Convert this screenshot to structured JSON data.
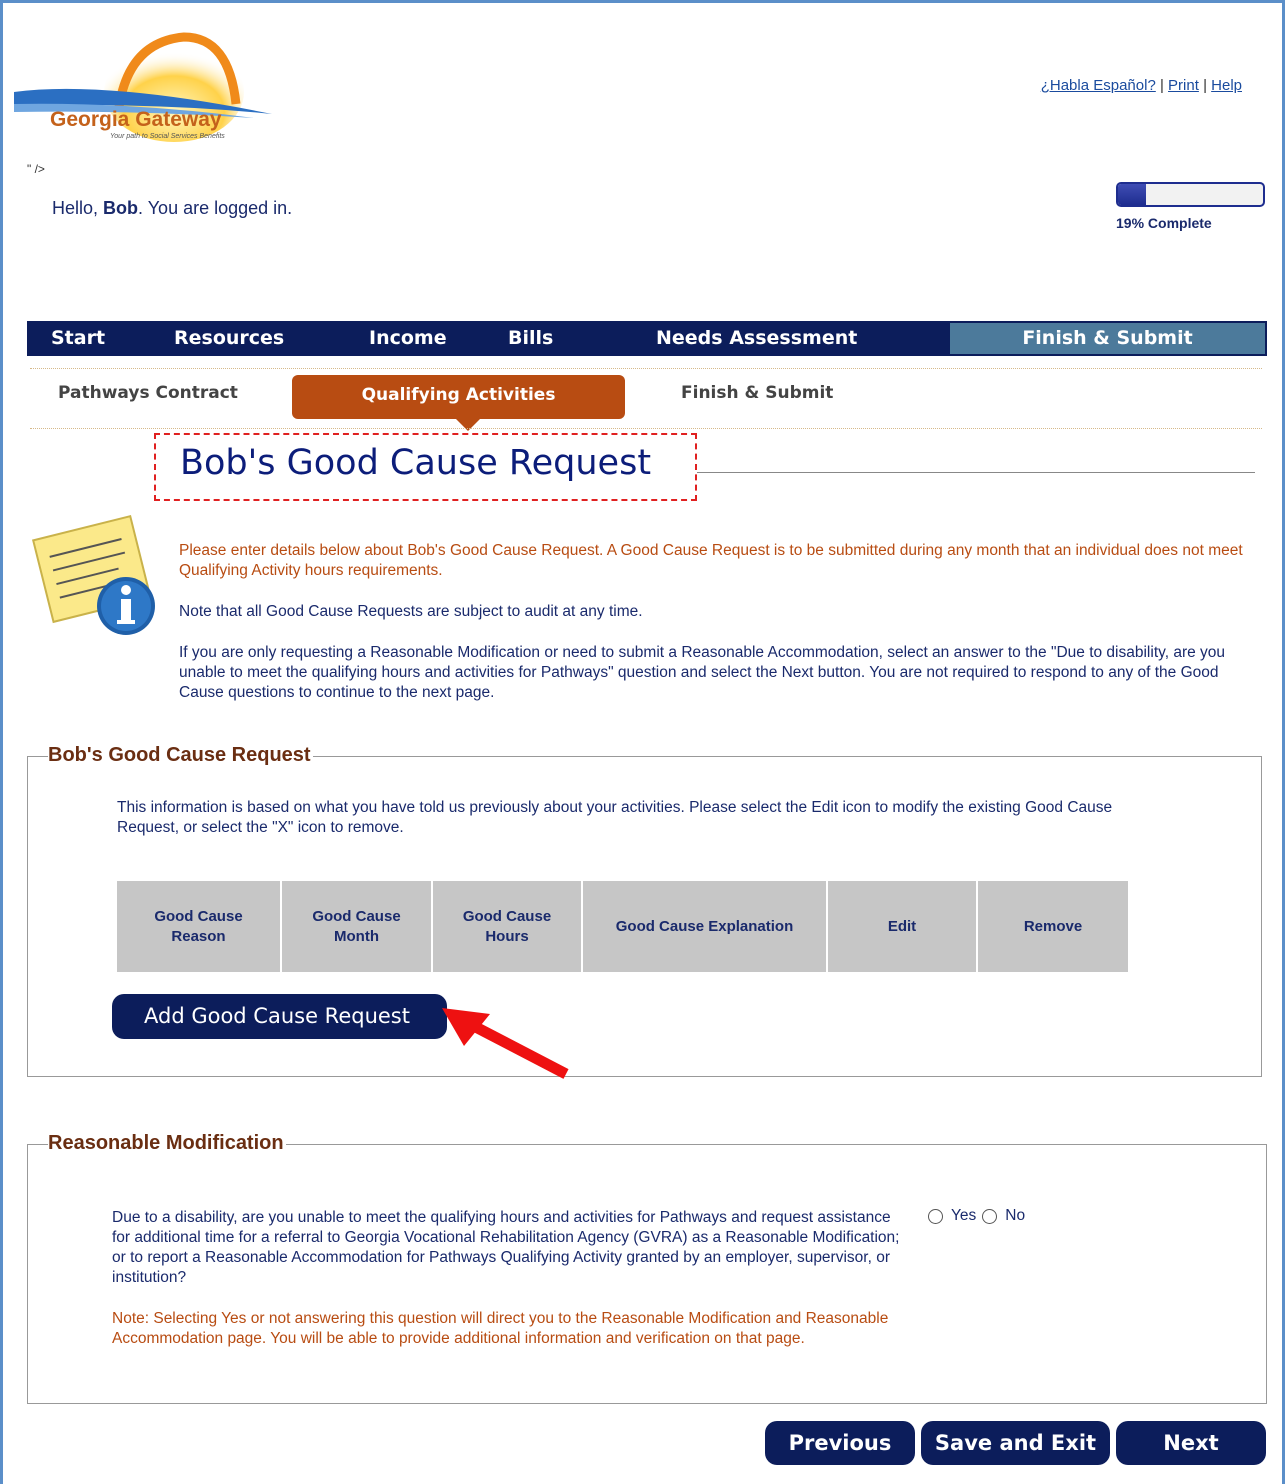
{
  "header": {
    "logo_text": "Georgia Gateway",
    "logo_tagline": "Your path to Social Services Benefits",
    "links": [
      "¿Habla Español?",
      "Print",
      "Help"
    ],
    "stray_text": "\" />",
    "greeting_prefix": "Hello, ",
    "user_name": "Bob",
    "greeting_suffix": ". You are logged in.",
    "progress_percent": 19,
    "progress_label": "19% Complete"
  },
  "main_nav": {
    "items": [
      "Start",
      "Resources",
      "Income",
      "Bills",
      "Needs Assessment",
      "Finish & Submit"
    ],
    "active": "Finish & Submit"
  },
  "sub_nav": {
    "items": [
      "Pathways Contract",
      "Qualifying Activities",
      "Finish & Submit"
    ],
    "active": "Qualifying Activities"
  },
  "page": {
    "title": "Bob's Good Cause Request",
    "intro_p1": "Please enter details below about Bob's Good Cause Request. A Good Cause Request is to be submitted during any month that an individual does not meet Qualifying Activity hours requirements.",
    "intro_p2": "Note that all Good Cause Requests are subject to audit at any time.",
    "intro_p3": "If you are only requesting a Reasonable Modification or need to submit a Reasonable Accommodation, select an answer to the \"Due to disability, are you unable to meet the qualifying hours and activities for Pathways\" question and select the Next button. You are not required to respond to any of the Good Cause questions to continue to the next page."
  },
  "good_cause_section": {
    "legend": "Bob's Good Cause Request",
    "description": "This information is based on what you have told us previously about your activities. Please select the Edit icon to modify the existing Good Cause Request, or select the \"X\" icon to remove.",
    "columns": [
      "Good Cause Reason",
      "Good Cause Month",
      "Good Cause Hours",
      "Good Cause Explanation",
      "Edit",
      "Remove"
    ],
    "rows": [],
    "add_button": "Add Good Cause Request"
  },
  "reasonable_mod_section": {
    "legend": "Reasonable Modification",
    "question": "Due to a disability, are you unable to meet the qualifying hours and activities for Pathways and request assistance for additional time for a referral to Georgia Vocational Rehabilitation Agency (GVRA) as a Reasonable Modification; or to report a Reasonable Accommodation for Pathways Qualifying Activity granted by an employer, supervisor, or institution?",
    "options": [
      "Yes",
      "No"
    ],
    "selected": null,
    "note": "Note: Selecting Yes or not answering this question will direct you to the Reasonable Modification and Reasonable Accommodation page. You will be able to provide additional information and verification on that page."
  },
  "footer_buttons": {
    "previous": "Previous",
    "save_exit": "Save and Exit",
    "next": "Next"
  },
  "colors": {
    "navy": "#0c1d5b",
    "orange_tab": "#b84c12",
    "active_nav": "#4c7a9b",
    "annotation_red": "#e02020"
  }
}
